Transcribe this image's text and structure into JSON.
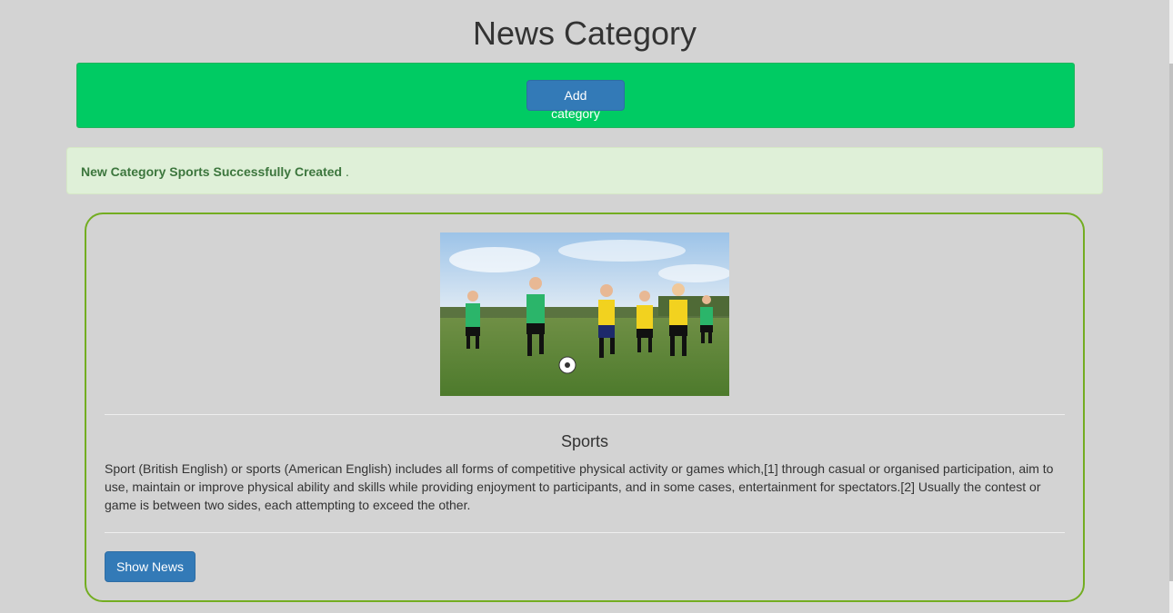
{
  "page": {
    "title": "News Category"
  },
  "toolbar": {
    "add_label": "Add category"
  },
  "alert": {
    "message_bold": "New Category Sports Successfully Created",
    "message_tail": " ."
  },
  "category": {
    "name": "Sports",
    "image_icon": "soccer-photo",
    "description": "Sport (British English) or sports (American English) includes all forms of competitive physical activity or games which,[1] through casual or organised participation, aim to use, maintain or improve physical ability and skills while providing enjoyment to participants, and in some cases, entertainment for spectators.[2] Usually the contest or game is between two sides, each attempting to exceed the other.",
    "show_label": "Show News"
  },
  "colors": {
    "background": "#d3d3d3",
    "green_bar": "#00cb63",
    "primary_button": "#337ab7",
    "alert_bg": "#dff0d8",
    "alert_text": "#3c763d",
    "card_border": "#73ad21"
  }
}
